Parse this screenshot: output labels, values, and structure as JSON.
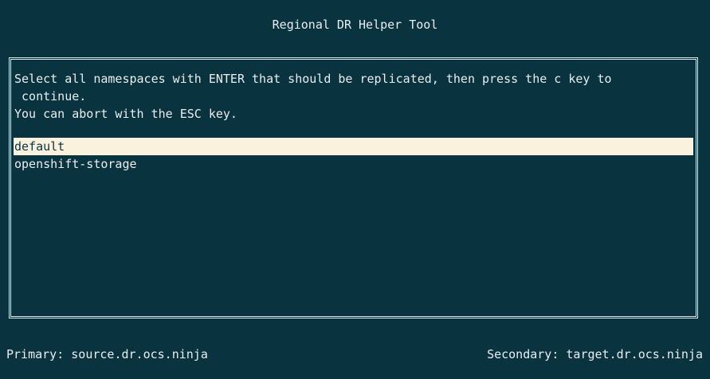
{
  "app": {
    "title": "Regional DR Helper Tool"
  },
  "panel": {
    "instruction_line1": "Select all namespaces with ENTER that should be replicated, then press the c key to",
    "instruction_line2": " continue.",
    "instruction_line3": "You can abort with the ESC key."
  },
  "namespaces": [
    {
      "name": "default",
      "highlighted": true
    },
    {
      "name": "openshift-storage",
      "highlighted": false
    }
  ],
  "status": {
    "primary": "Primary: source.dr.ocs.ninja",
    "secondary": "Secondary: target.dr.ocs.ninja"
  },
  "colors": {
    "background": "#0a3340",
    "text": "#e8eef0",
    "highlight": "#fbf2de"
  }
}
